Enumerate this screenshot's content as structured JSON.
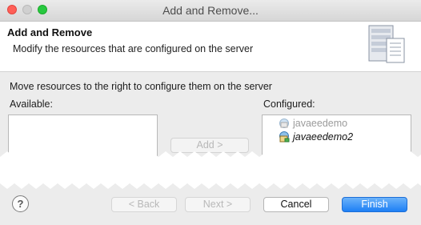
{
  "window": {
    "title": "Add and Remove..."
  },
  "banner": {
    "title": "Add and Remove",
    "description": "Modify the resources that are configured on the server"
  },
  "body": {
    "instruction": "Move resources to the right to configure them on the server",
    "available_label": "Available:",
    "configured_label": "Configured:",
    "configured_items": [
      {
        "label": "javaeedemo",
        "state": "disabled"
      },
      {
        "label": "javaeedemo2",
        "state": "normal"
      }
    ],
    "add_button": "Add >"
  },
  "footer": {
    "help_label": "?",
    "back": "< Back",
    "next": "Next >",
    "cancel": "Cancel",
    "finish": "Finish"
  },
  "colors": {
    "accent": "#1e7ff5",
    "close": "#ff5f57",
    "maximize": "#28c840",
    "window_bg": "#ececec"
  }
}
